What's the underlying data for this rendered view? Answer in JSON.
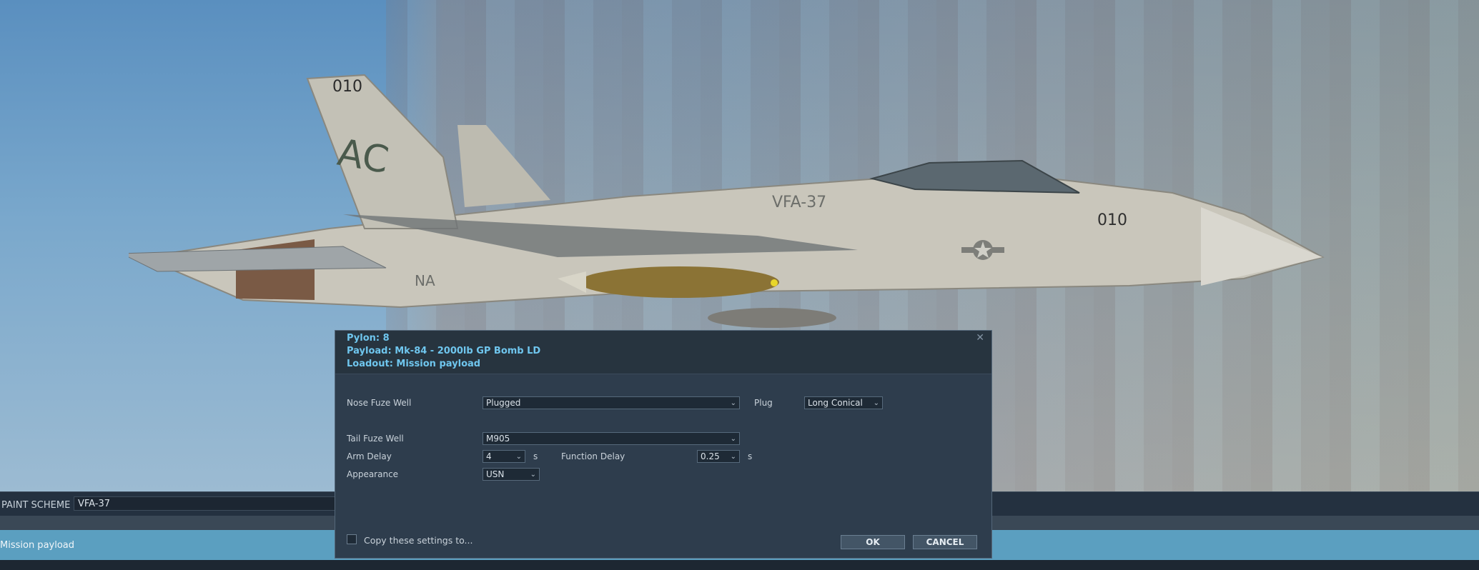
{
  "aircraft": {
    "tail_number": "010",
    "nose_number": "010",
    "squadron_marking": "VFA-37",
    "tail_code": "AC",
    "nav_marking": "NA"
  },
  "dialog": {
    "pylon": "Pylon: 8",
    "payload": "Payload: Mk-84 - 2000lb GP Bomb LD",
    "loadout": "Loadout: Mission payload",
    "nose_fuze_label": "Nose Fuze Well",
    "nose_fuze_value": "Plugged",
    "plug_label": "Plug",
    "plug_value": "Long Conical",
    "tail_fuze_label": "Tail Fuze Well",
    "tail_fuze_value": "M905",
    "arm_delay_label": "Arm Delay",
    "arm_delay_value": "4",
    "arm_delay_unit": "s",
    "function_delay_label": "Function Delay",
    "function_delay_value": "0.25",
    "function_delay_unit": "s",
    "appearance_label": "Appearance",
    "appearance_value": "USN",
    "copy_label": "Copy these settings to...",
    "ok_label": "OK",
    "cancel_label": "CANCEL"
  },
  "paint_scheme": {
    "label": "PAINT SCHEME",
    "value": "VFA-37"
  },
  "loadout_bar": {
    "label": "Mission payload"
  }
}
